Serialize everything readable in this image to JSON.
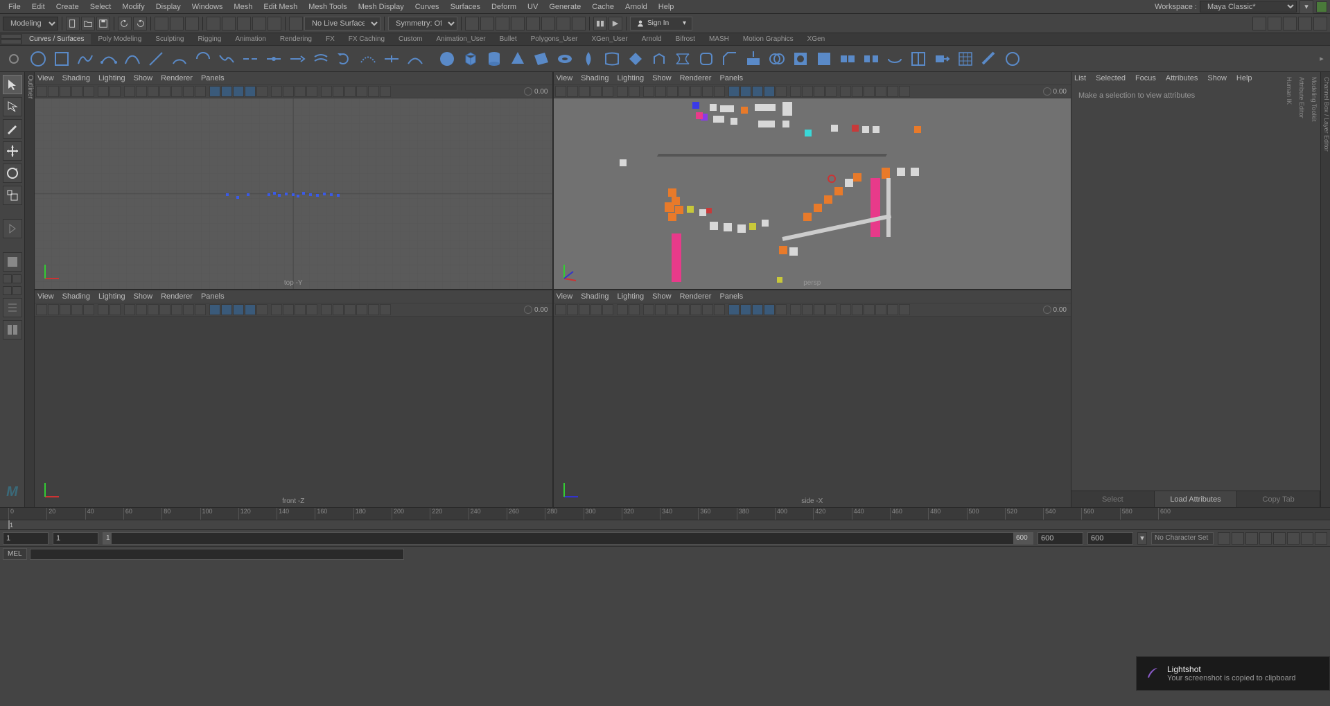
{
  "menubar": {
    "items": [
      "File",
      "Edit",
      "Create",
      "Select",
      "Modify",
      "Display",
      "Windows",
      "Mesh",
      "Edit Mesh",
      "Mesh Tools",
      "Mesh Display",
      "Curves",
      "Surfaces",
      "Deform",
      "UV",
      "Generate",
      "Cache",
      "Arnold",
      "Help"
    ],
    "workspace_label": "Workspace :",
    "workspace_value": "Maya Classic*"
  },
  "toolbar": {
    "mode": "Modeling",
    "live_surface": "No Live Surface",
    "symmetry": "Symmetry: Off",
    "signin": "Sign In"
  },
  "shelf_tabs": [
    "Curves / Surfaces",
    "Poly Modeling",
    "Sculpting",
    "Rigging",
    "Animation",
    "Rendering",
    "FX",
    "FX Caching",
    "Custom",
    "Animation_User",
    "Bullet",
    "Polygons_User",
    "XGen_User",
    "Arnold",
    "Bifrost",
    "MASH",
    "Motion Graphics",
    "XGen"
  ],
  "shelf_active_tab": 0,
  "viewport_menu": [
    "View",
    "Shading",
    "Lighting",
    "Show",
    "Renderer",
    "Panels"
  ],
  "viewport_labels": {
    "top": "top -Y",
    "persp": "persp",
    "front": "front -Z",
    "side": "side -X"
  },
  "viewport_frame": "0.00",
  "outliner_label": "Outliner",
  "right_tabs": [
    "Channel Box / Layer Editor",
    "Modeling Toolkit",
    "Attribute Editor",
    "Human IK"
  ],
  "attr_panel": {
    "menu": [
      "List",
      "Selected",
      "Focus",
      "Attributes",
      "Show",
      "Help"
    ],
    "placeholder": "Make a selection to view attributes",
    "footer": [
      "Select",
      "Load Attributes",
      "Copy Tab"
    ]
  },
  "timeline": {
    "ticks": [
      0,
      20,
      40,
      60,
      80,
      100,
      120,
      140,
      160,
      180,
      200,
      220,
      240,
      260,
      280,
      300,
      320,
      340,
      360,
      380,
      400,
      420,
      440,
      460,
      480,
      500,
      520,
      540,
      560,
      580,
      600
    ],
    "current": 1,
    "start": 1,
    "end": 600,
    "range_start": 1,
    "range_end_a": 600,
    "range_end_b": 600,
    "range_end_c": 600,
    "char_set": "No Character Set"
  },
  "cmd": {
    "label": "MEL"
  },
  "toast": {
    "title": "Lightshot",
    "body": "Your screenshot is copied to clipboard"
  }
}
